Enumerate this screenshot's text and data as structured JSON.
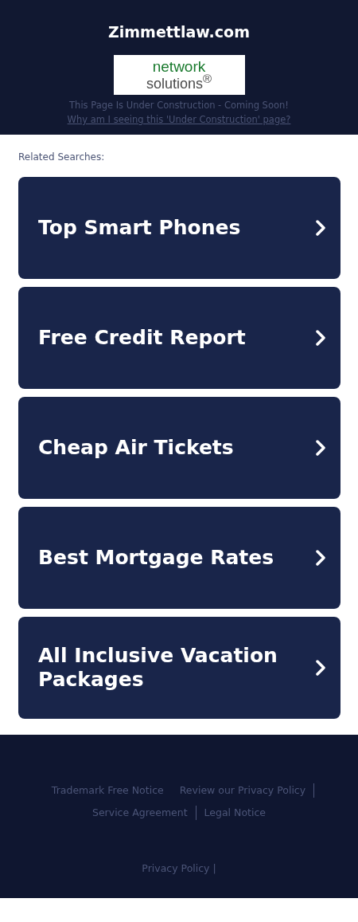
{
  "header": {
    "title": "Zimmettlaw.com",
    "logo": {
      "line1": "network",
      "line2": "solutions$^{®}$"
    },
    "notice": "This Page Is Under Construction - Coming Soon!",
    "link": "Why am I seeing this 'Under Construction' page?"
  },
  "related": {
    "label": "Related Searches:",
    "items": [
      {
        "label": "Top Smart Phones"
      },
      {
        "label": "Free Credit Report"
      },
      {
        "label": "Cheap Air Tickets"
      },
      {
        "label": "Best Mortgage Rates"
      },
      {
        "label": "All Inclusive Vacation Packages"
      }
    ]
  },
  "footer": {
    "links": [
      {
        "label": "Trademark Free Notice",
        "divider_after": false
      },
      {
        "label": "Review our Privacy Policy",
        "divider_after": true
      },
      {
        "label": "Service Agreement",
        "divider_after": true
      },
      {
        "label": "Legal Notice",
        "divider_after": false
      }
    ],
    "bottom_link": "Privacy Policy |"
  }
}
